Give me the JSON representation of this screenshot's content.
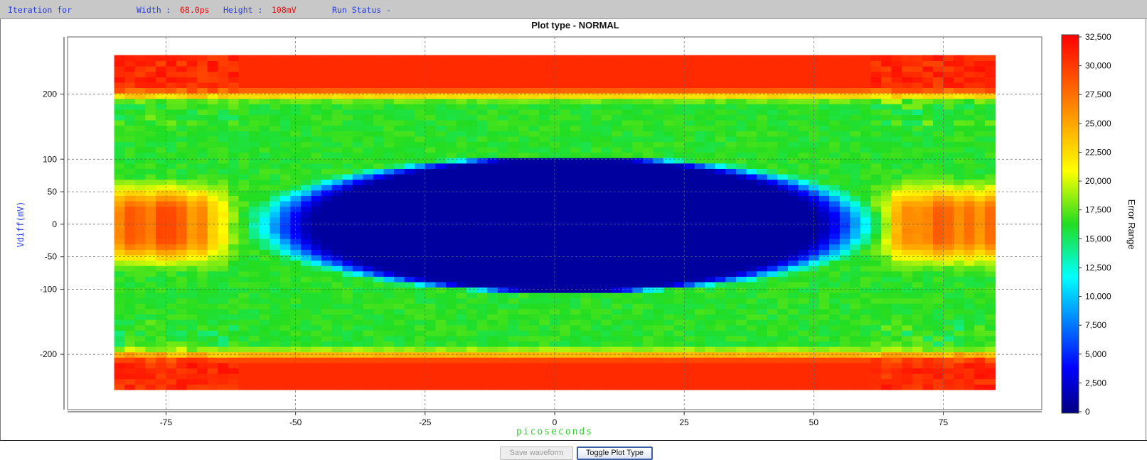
{
  "status_bar": {
    "iteration_label": "Iteration for",
    "width_label": "Width :",
    "width_value": "68.0ps",
    "height_label": "Height :",
    "height_value": "108mV",
    "run_status_label": "Run Status -"
  },
  "buttons": {
    "save_waveform": "Save waveform",
    "toggle_plot_type": "Toggle Plot Type"
  },
  "colors": {
    "label_blue": "#2a3fd6",
    "value_red": "#e01010",
    "xlabel_green": "#39d039"
  },
  "chart_data": {
    "type": "heatmap",
    "title": "Plot type - NORMAL",
    "xlabel": "picoseconds",
    "ylabel": "Vdiff(mV)",
    "colorbar_label": "Error Range",
    "xlim": [
      -94,
      94
    ],
    "ylim": [
      -285,
      288
    ],
    "x_ticks": [
      -75,
      -50,
      -25,
      0,
      25,
      50,
      75
    ],
    "y_ticks": [
      -200,
      -100,
      -50,
      0,
      50,
      100,
      200
    ],
    "colorbar_range": [
      0,
      32500
    ],
    "colorbar_ticks": [
      "32,500",
      "30,000",
      "27,500",
      "25,000",
      "22,500",
      "20,000",
      "17,500",
      "15,000",
      "12,500",
      "10,000",
      "7,500",
      "5,000",
      "2,500",
      "0"
    ],
    "data_extent": {
      "x": [
        -85,
        85
      ],
      "y": [
        -254,
        260
      ]
    },
    "eye_opening": {
      "width_ps": 68.0,
      "height_mV": 108,
      "center_x": 0,
      "center_y": 0
    },
    "colormap": "jet",
    "grid": true
  }
}
